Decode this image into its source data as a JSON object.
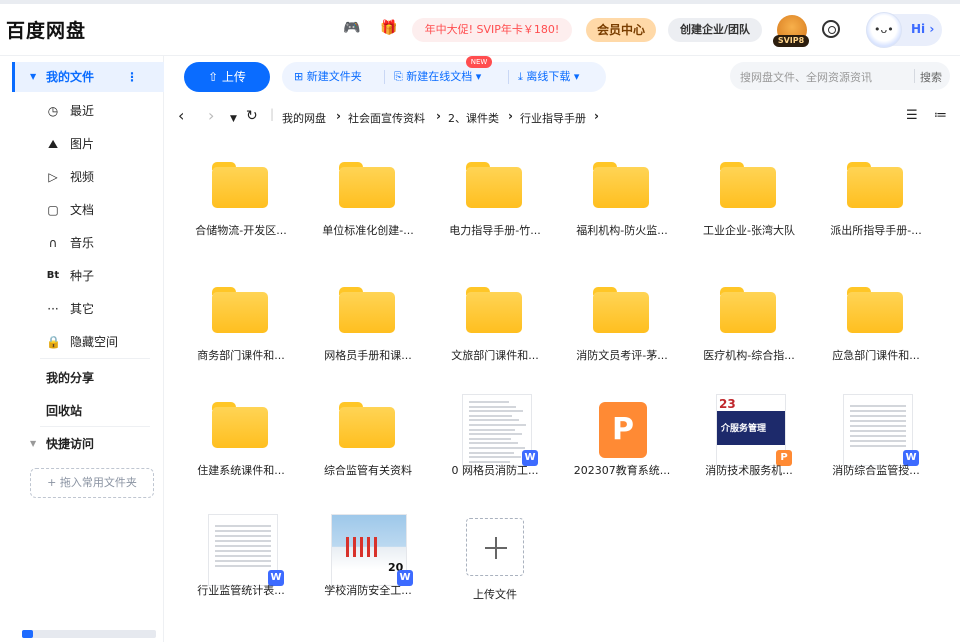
{
  "header": {
    "logo": "百度网盘",
    "promo": "年中大促! SVIP年卡￥180!",
    "vip_center": "会员中心",
    "enterprise": "创建企业/团队",
    "svip_badge": "SVIP8",
    "hi": "Hi ›"
  },
  "toolbar": {
    "upload": "⇧ 上传",
    "new_folder": "新建文件夹",
    "new_online_doc": "新建在线文档 ▾",
    "new_badge": "NEW",
    "offline_download": "离线下载 ▾",
    "search_placeholder": "搜网盘文件、全网资源资讯",
    "search_button": "搜索"
  },
  "breadcrumb": [
    "我的网盘",
    "社会面宣传资料",
    "2、课件类",
    "行业指导手册"
  ],
  "sidebar": {
    "my_files": "我的文件",
    "items": [
      {
        "icon": "clock-icon",
        "glyph": "◷",
        "label": "最近"
      },
      {
        "icon": "image-icon",
        "glyph": "⛰",
        "label": "图片"
      },
      {
        "icon": "video-icon",
        "glyph": "▷",
        "label": "视频"
      },
      {
        "icon": "document-icon",
        "glyph": "▢",
        "label": "文档"
      },
      {
        "icon": "headphones-icon",
        "glyph": "∩",
        "label": "音乐"
      },
      {
        "icon": "torrent-icon",
        "glyph": "Bt",
        "label": "种子"
      },
      {
        "icon": "more-icon",
        "glyph": "···",
        "label": "其它"
      },
      {
        "icon": "lock-icon",
        "glyph": "🔒",
        "label": "隐藏空间"
      }
    ],
    "my_share": "我的分享",
    "recycle": "回收站",
    "quick_access": "快捷访问",
    "drag_hint": "+ 拖入常用文件夹",
    "storage_used": 0.08
  },
  "files": [
    {
      "name": "合储物流-开发区...",
      "type": "folder"
    },
    {
      "name": "单位标准化创建-...",
      "type": "folder"
    },
    {
      "name": "电力指导手册-竹...",
      "type": "folder"
    },
    {
      "name": "福利机构-防火监...",
      "type": "folder"
    },
    {
      "name": "工业企业-张湾大队",
      "type": "folder"
    },
    {
      "name": "派出所指导手册-...",
      "type": "folder"
    },
    {
      "name": "商务部门课件和...",
      "type": "folder"
    },
    {
      "name": "网格员手册和课...",
      "type": "folder"
    },
    {
      "name": "文旅部门课件和...",
      "type": "folder"
    },
    {
      "name": "消防文员考评-茅...",
      "type": "folder"
    },
    {
      "name": "医疗机构-综合指...",
      "type": "folder"
    },
    {
      "name": "应急部门课件和...",
      "type": "folder"
    },
    {
      "name": "住建系统课件和...",
      "type": "folder"
    },
    {
      "name": "综合监管有关资料",
      "type": "folder"
    },
    {
      "name": "0 网格员消防工...",
      "type": "word"
    },
    {
      "name": "202307教育系统...",
      "type": "ppt"
    },
    {
      "name": "消防技术服务机...",
      "type": "ppt-thumb",
      "thumb_text": "介服务管理"
    },
    {
      "name": "消防综合监管授...",
      "type": "word-table"
    },
    {
      "name": "行业监管统计表...",
      "type": "word-table"
    },
    {
      "name": "学校消防安全工...",
      "type": "word-photo",
      "thumb_text": "20"
    },
    {
      "name": "上传文件",
      "type": "upload"
    }
  ]
}
